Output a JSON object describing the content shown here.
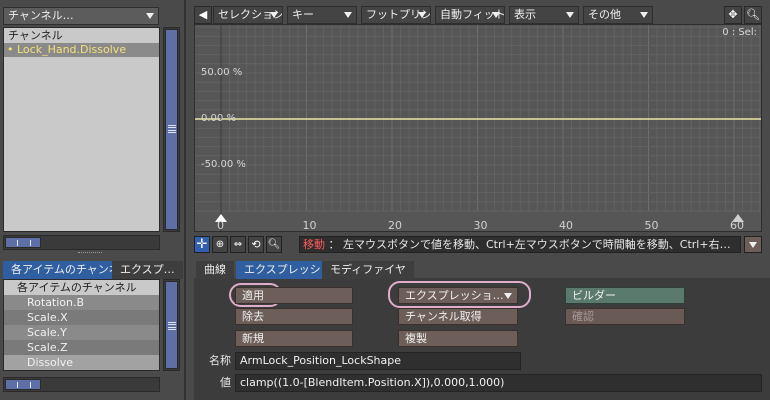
{
  "left": {
    "channel_dropdown": "チャンネル…",
    "channel_header": "チャンネル",
    "channel_item": "• Lock_Hand.Dissolve",
    "tabs": [
      "各アイテムのチャンネル",
      "エクスプ…"
    ],
    "tree_root": "各アイテムのチャンネル",
    "tree_items": [
      "Rotation.B",
      "Scale.X",
      "Scale.Y",
      "Scale.Z",
      "Dissolve"
    ]
  },
  "toolbar": {
    "menus": [
      "セレクション",
      "キー",
      "フットプリント",
      "自動フィット",
      "表示",
      "その他"
    ]
  },
  "graph": {
    "sel_readout": "0 : Sel:",
    "y_labels": [
      "50.00 %",
      "0.00 %",
      "-50.00 %"
    ],
    "x_ticks": [
      "0",
      "10",
      "20",
      "30",
      "40",
      "50",
      "60"
    ],
    "marker_label": "0"
  },
  "status": {
    "mode": "移動",
    "hint": "：  左マウスボタンで値を移動、Ctrl+左マウスボタンで時間軸を移動、Ctrl+右…"
  },
  "bottom_tabs": [
    "曲線",
    "エクスプレッション",
    "モディファイヤ"
  ],
  "expression": {
    "apply": "適用",
    "remove": "除去",
    "new": "新規",
    "expr_dropdown": "エクスプレッショ…",
    "get_channel": "チャンネル取得",
    "duplicate": "複製",
    "builder": "ビルダー",
    "confirm": "確認",
    "name_label": "名称",
    "name_value": "ArmLock_Position_LockShape",
    "value_label": "値",
    "value_value": "clamp((1.0-[BlendItem.Position.X]),0.000,1.000)"
  },
  "colors": {
    "curve": "#e8e6a2",
    "highlight_ring": "#e0aecb",
    "builder_btn": "#5a7a6e",
    "confirm_btn": "#6a5a56"
  }
}
